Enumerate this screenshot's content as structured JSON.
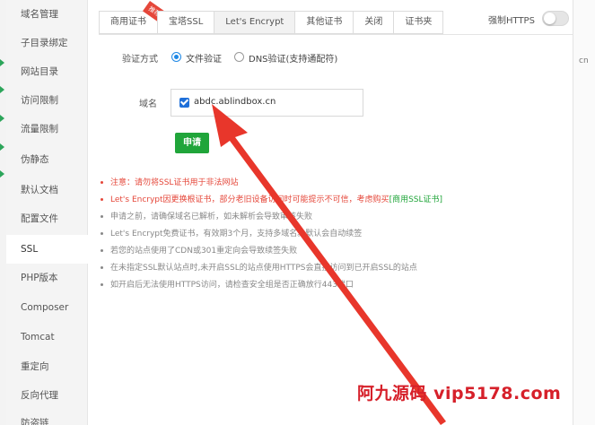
{
  "sidebar": {
    "items": [
      {
        "label": "域名管理"
      },
      {
        "label": "子目录绑定"
      },
      {
        "label": "网站目录"
      },
      {
        "label": "访问限制"
      },
      {
        "label": "流量限制"
      },
      {
        "label": "伪静态"
      },
      {
        "label": "默认文档"
      },
      {
        "label": "配置文件"
      },
      {
        "label": "SSL",
        "active": true
      },
      {
        "label": "PHP版本"
      },
      {
        "label": "Composer"
      },
      {
        "label": "Tomcat"
      },
      {
        "label": "重定向"
      },
      {
        "label": "反向代理"
      },
      {
        "label": "防盗链"
      }
    ]
  },
  "tabs": [
    {
      "label": "商用证书",
      "badge": "推荐"
    },
    {
      "label": "宝塔SSL"
    },
    {
      "label": "Let's Encrypt",
      "active": true
    },
    {
      "label": "其他证书"
    },
    {
      "label": "关闭"
    },
    {
      "label": "证书夹"
    }
  ],
  "force_https": {
    "label": "强制HTTPS",
    "enabled": false
  },
  "right_panel": {
    "text": "cn"
  },
  "verify": {
    "label": "验证方式",
    "options": [
      {
        "label": "文件验证",
        "checked": true
      },
      {
        "label": "DNS验证(支持通配符)",
        "checked": false
      }
    ]
  },
  "domain": {
    "label": "域名",
    "value": "abdc.ablindbox.cn",
    "checked": true
  },
  "apply_button": {
    "label": "申请"
  },
  "notes": [
    {
      "text": "注意：请勿将SSL证书用于非法网站",
      "color": "red"
    },
    {
      "text": "Let's Encrypt因更换根证书，部分老旧设备访问时可能提示不可信，考虑购买",
      "link": "[商用SSL证书]",
      "color": "red"
    },
    {
      "text": "申请之前，请确保域名已解析，如未解析会导致审核失败",
      "color": "gray"
    },
    {
      "text": "Let's Encrypt免费证书，有效期3个月，支持多域名。默认会自动续签",
      "color": "gray"
    },
    {
      "text": "若您的站点使用了CDN或301重定向会导致续签失败",
      "color": "gray"
    },
    {
      "text": "在未指定SSL默认站点时,未开启SSL的站点使用HTTPS会直接访问到已开启SSL的站点",
      "color": "gray"
    },
    {
      "text": "如开启后无法使用HTTPS访问，请检查安全组是否正确放行443端口",
      "color": "gray"
    }
  ],
  "watermark": "阿九源码  vip5178.com",
  "colors": {
    "accent": "#20a53a",
    "primary": "#1e6fd9",
    "warning": "#e5473a",
    "annotation": "#e8362b"
  }
}
